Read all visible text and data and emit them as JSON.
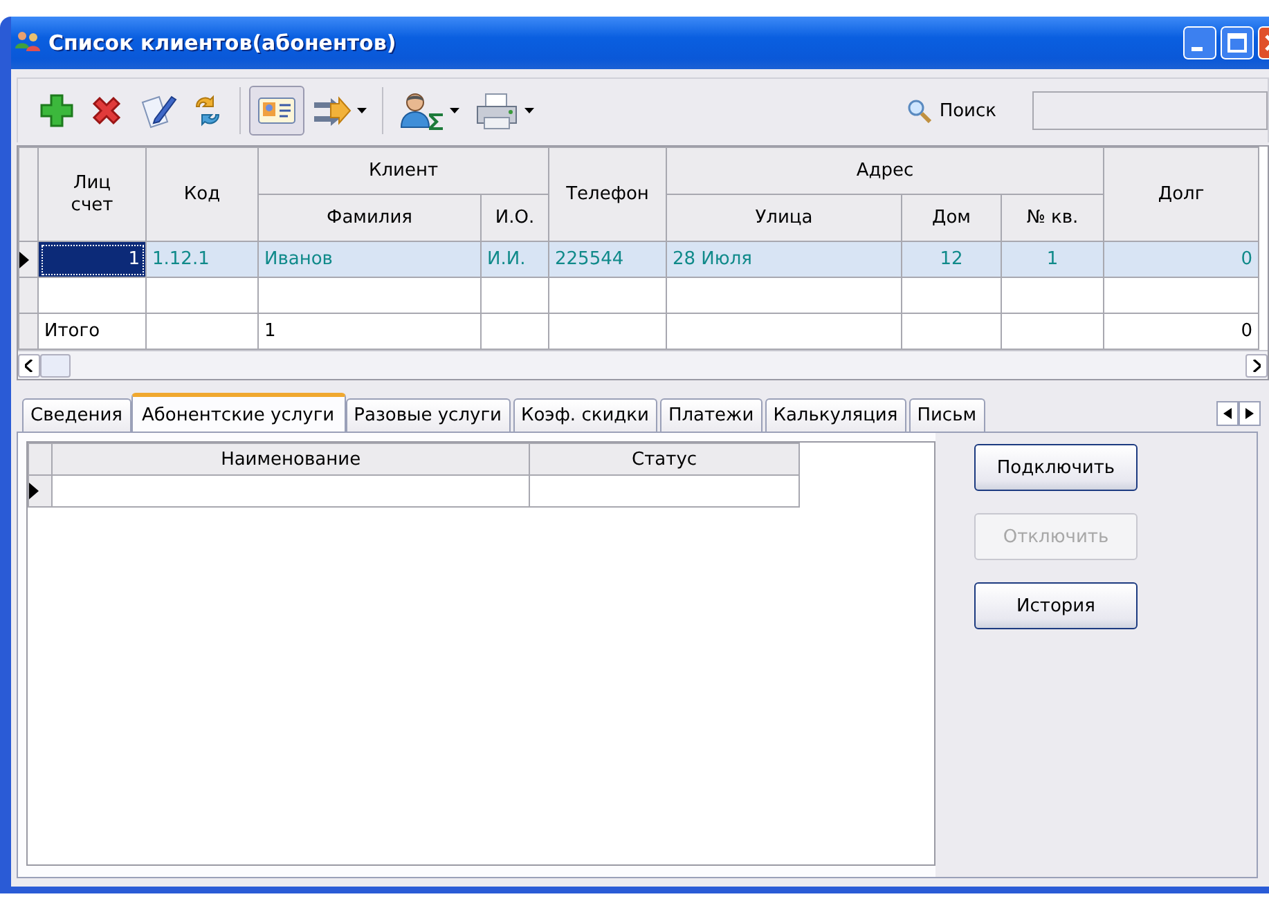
{
  "window": {
    "title": "Список клиентов(абонентов)"
  },
  "toolbar": {
    "groups": [
      [
        {
          "pressed": false,
          "menu": false
        },
        {
          "pressed": false,
          "menu": false
        },
        {
          "pressed": false,
          "menu": false
        },
        {
          "pressed": false,
          "menu": false
        }
      ],
      [
        {
          "pressed": true,
          "menu": false
        },
        {
          "pressed": false,
          "menu": true
        }
      ],
      [
        {
          "pressed": false,
          "menu": true
        },
        {
          "pressed": false,
          "menu": true
        }
      ]
    ],
    "search_label": "Поиск"
  },
  "grid": {
    "columns": [
      {
        "label": "Лиц счет"
      },
      {
        "label": "Код"
      },
      {
        "label": "Клиент",
        "children": [
          {
            "label": "Фамилия"
          },
          {
            "label": "И.О."
          }
        ]
      },
      {
        "label": "Телефон"
      },
      {
        "label": "Адрес",
        "children": [
          {
            "label": "Улица"
          },
          {
            "label": "Дом"
          },
          {
            "label": "№ кв."
          }
        ]
      },
      {
        "label": "Долг"
      }
    ],
    "rows": [
      {
        "kind": "record",
        "selected": true,
        "account": "1",
        "code": "1.12.1",
        "surname": "Иванов",
        "initials": "И.И.",
        "phone": "225544",
        "street": "28 Июля",
        "house": "12",
        "flat": "1",
        "debt": "0"
      },
      {
        "kind": "blank",
        "selected": false
      },
      {
        "kind": "total",
        "selected": false,
        "label": "Итого",
        "count": "1",
        "debt": "0"
      }
    ]
  },
  "tabs": [
    {
      "label": "Сведения",
      "selected": false
    },
    {
      "label": "Абонентские услуги",
      "selected": true
    },
    {
      "label": "Разовые услуги",
      "selected": false
    },
    {
      "label": "Коэф. скидки",
      "selected": false
    },
    {
      "label": "Платежи",
      "selected": false
    },
    {
      "label": "Калькуляция",
      "selected": false
    },
    {
      "label": "Письм",
      "selected": false
    }
  ],
  "services": {
    "columns": [
      "Наименование",
      "Статус"
    ],
    "rows": [
      {
        "selected": true
      }
    ]
  },
  "buttons": [
    {
      "label": "Подключить",
      "disabled": false
    },
    {
      "label": "Отключить",
      "disabled": true
    },
    {
      "label": "История",
      "disabled": false
    }
  ]
}
